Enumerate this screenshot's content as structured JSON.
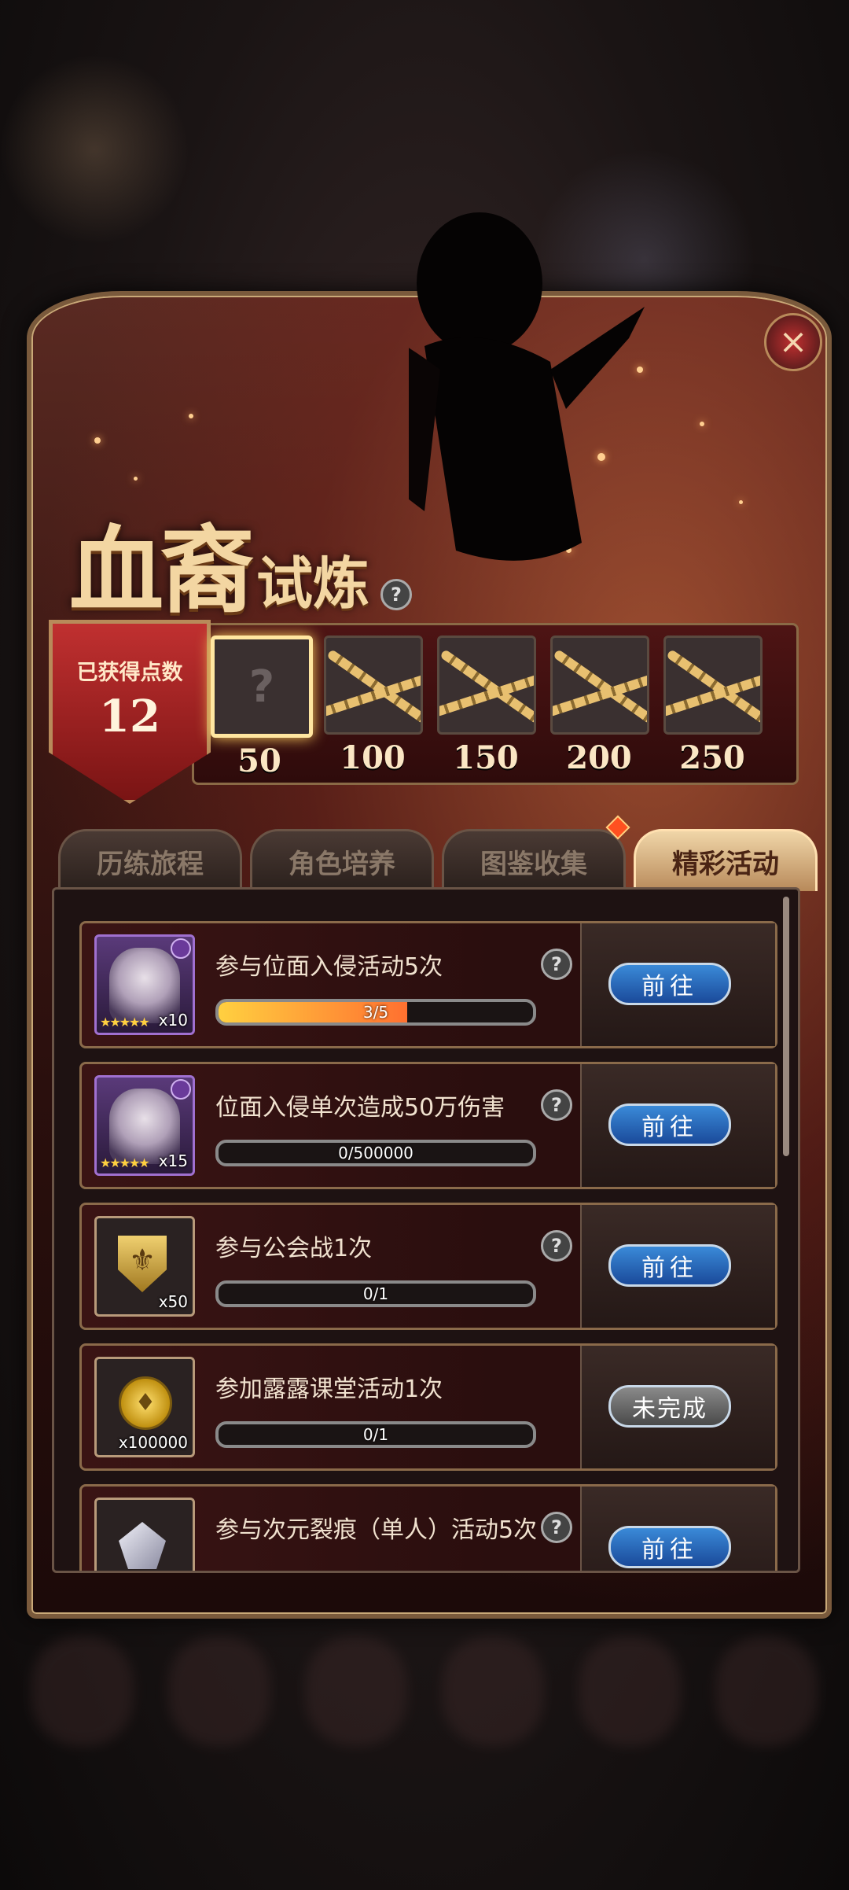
{
  "title": {
    "main": "血裔",
    "sub": "试炼"
  },
  "points": {
    "label": "已获得点数",
    "value": "12"
  },
  "milestones": [
    {
      "value": "50",
      "state": "unlocked",
      "placeholder": "?"
    },
    {
      "value": "100",
      "state": "locked"
    },
    {
      "value": "150",
      "state": "locked"
    },
    {
      "value": "200",
      "state": "locked"
    },
    {
      "value": "250",
      "state": "locked"
    }
  ],
  "tabs": [
    {
      "label": "历练旅程"
    },
    {
      "label": "角色培养"
    },
    {
      "label": "图鉴收集"
    },
    {
      "label": "精彩活动",
      "active": true
    }
  ],
  "tasks": [
    {
      "title": "参与位面入侵活动5次",
      "progress": "3/5",
      "progress_value": 0.6,
      "button": "前往",
      "reward_qty": "x10",
      "reward_icon": "character-portrait-icon"
    },
    {
      "title": "位面入侵单次造成50万伤害",
      "progress": "0/500000",
      "progress_value": 0,
      "button": "前往",
      "reward_qty": "x15",
      "reward_icon": "character-portrait-icon"
    },
    {
      "title": "参与公会战1次",
      "progress": "0/1",
      "progress_value": 0,
      "button": "前往",
      "reward_qty": "x50",
      "reward_icon": "guild-shield-icon"
    },
    {
      "title": "参加露露课堂活动1次",
      "progress": "0/1",
      "progress_value": 0,
      "button": "未完成",
      "reward_qty": "x100000",
      "reward_icon": "gold-coin-icon"
    },
    {
      "title": "参与次元裂痕（单人）活动5次",
      "progress": "",
      "progress_value": 0,
      "button": "前往",
      "reward_qty": "",
      "reward_icon": "crystal-icon"
    }
  ],
  "colors": {
    "accent_gold": "#f3d6a2",
    "button_blue": "#1a4a9a",
    "progress_orange": "#ff7030"
  }
}
